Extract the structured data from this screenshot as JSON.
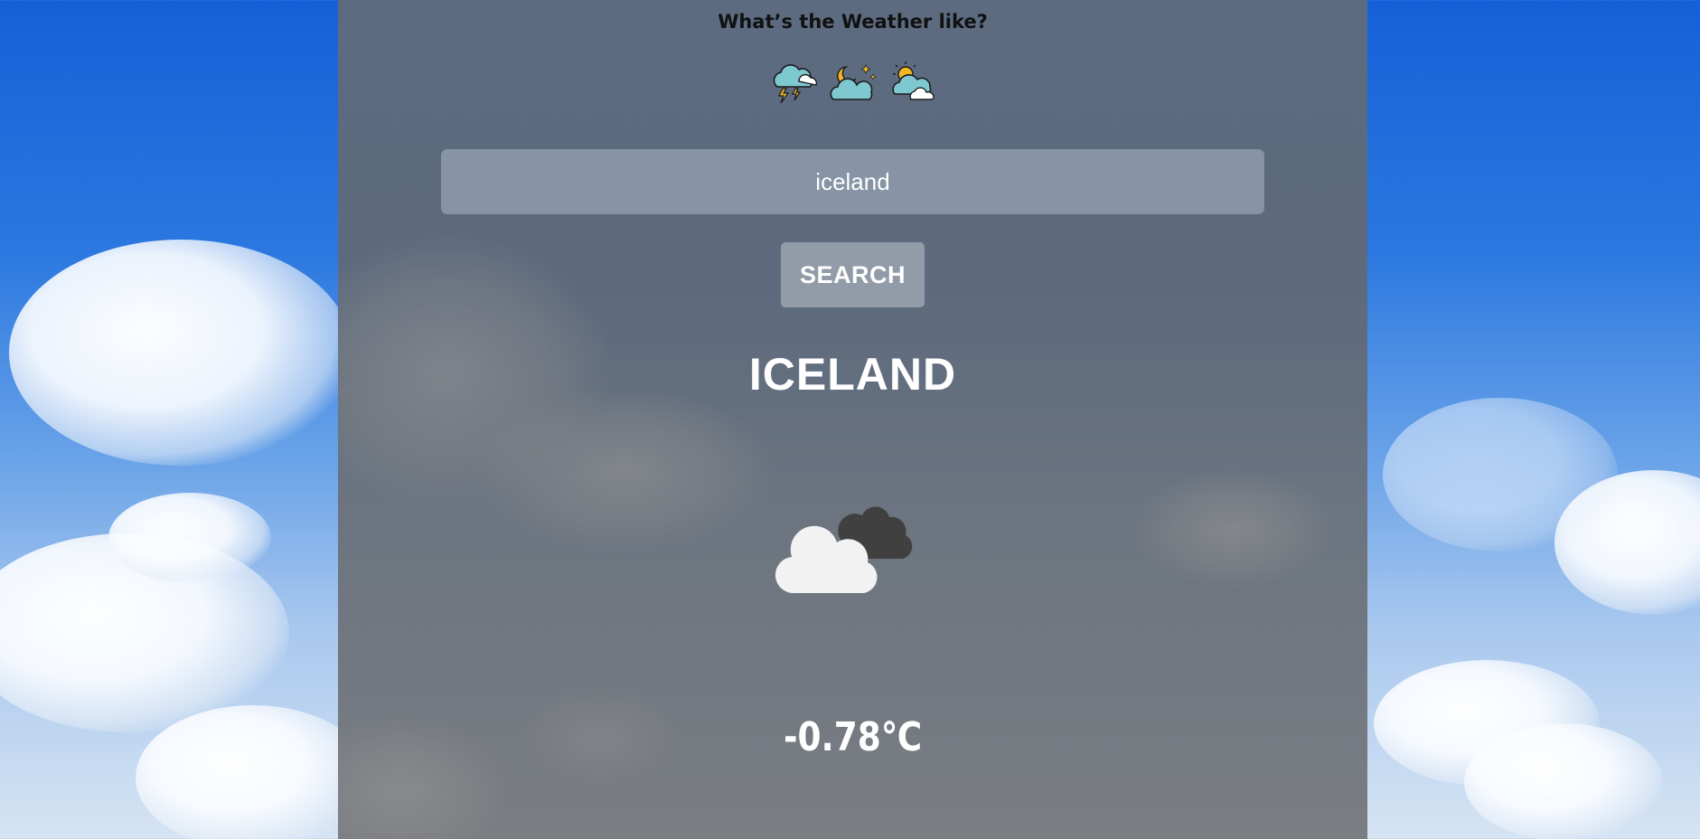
{
  "header": {
    "title": "What’s the Weather like?",
    "icons": [
      "thunderstorm-cloud-icon",
      "night-cloud-icon",
      "sun-cloud-icon"
    ]
  },
  "search": {
    "value": "iceland",
    "button_label": "SEARCH"
  },
  "result": {
    "city": "ICELAND",
    "condition_icon": "broken-clouds-icon",
    "temperature": "-0.78℃"
  },
  "colors": {
    "sky_blue": "#1560d8",
    "panel_overlay": "#5d6a7d",
    "text_light": "#ffffff",
    "text_dark": "#111111",
    "cloud_teal": "#7ec8d0",
    "accent_yellow": "#f2b824"
  }
}
